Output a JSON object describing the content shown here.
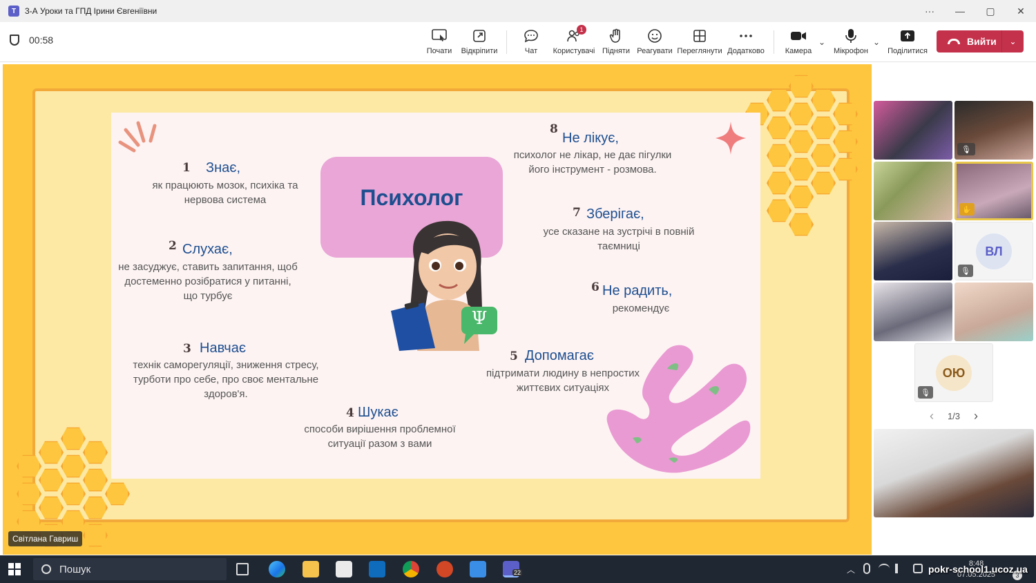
{
  "window": {
    "title": "3-А Уроки та ГПД Ірини Євгеніївни",
    "controls": {
      "more": "···",
      "minimize": "—",
      "restore": "▢",
      "close": "✕"
    }
  },
  "toolbar": {
    "timer": "00:58",
    "buttons": [
      {
        "label": "Почати",
        "icon": "present-screen-icon"
      },
      {
        "label": "Відкріпити",
        "icon": "popout-icon"
      },
      {
        "label": "Чат",
        "icon": "chat-icon"
      },
      {
        "label": "Користувачі",
        "icon": "people-icon",
        "badge": "1"
      },
      {
        "label": "Підняти",
        "icon": "raise-hand-icon"
      },
      {
        "label": "Реагувати",
        "icon": "smiley-icon"
      },
      {
        "label": "Переглянути",
        "icon": "view-grid-icon"
      },
      {
        "label": "Додатково",
        "icon": "more-icon"
      },
      {
        "label": "Камера",
        "icon": "camera-icon"
      },
      {
        "label": "Мікрофон",
        "icon": "microphone-icon"
      },
      {
        "label": "Поділитися",
        "icon": "share-icon"
      }
    ],
    "leave_label": "Вийти"
  },
  "slide": {
    "title": "Психолог",
    "items": [
      {
        "num": "1",
        "title": "Знає,",
        "text": "як працюють  мозок, психіка та нервова система"
      },
      {
        "num": "2",
        "title": "Слухає,",
        "text": "не засуджує, ставить запитання, щоб достеменно розібратися у питанні, що турбує"
      },
      {
        "num": "3",
        "title": "Навчає",
        "text": "технік саморегуляції, зниження стресу, турботи про себе, про своє ментальне здоров'я."
      },
      {
        "num": "4",
        "title": "Шукає",
        "text": "способи вирішення проблемної ситуації разом з вами"
      },
      {
        "num": "5",
        "title": "Допомагає",
        "text": "підтримати людину в непростих життєвих  ситуаціях"
      },
      {
        "num": "6",
        "title": "Не радить,",
        "text": "рекомендує"
      },
      {
        "num": "7",
        "title": "Зберігає,",
        "text": "усе сказане на зустрічі в повній таємниці"
      },
      {
        "num": "8",
        "title": "Не лікує,",
        "text": "психолог не лікар, не дає пігулки його інструмент - розмова."
      }
    ],
    "badge_symbol": "Ψ"
  },
  "presenter_name": "Світлана Гавриш",
  "participants": {
    "avatars": [
      {
        "initials": "ВЛ"
      },
      {
        "initials": "ОЮ"
      }
    ],
    "pager": {
      "prev": "‹",
      "page": "1/3",
      "next": "›"
    }
  },
  "taskbar": {
    "search_placeholder": "Пошук",
    "teams_badge": "22",
    "time": "8:48",
    "date": "07.05.2025",
    "notif": "3"
  },
  "watermark": "pokr-school1.ucoz.ua",
  "colors": {
    "accent_red": "#c4314b",
    "slide_yellow": "#fdc63e",
    "slide_blue_text": "#1d4e8f",
    "psy_pink": "#e9a6d7"
  }
}
